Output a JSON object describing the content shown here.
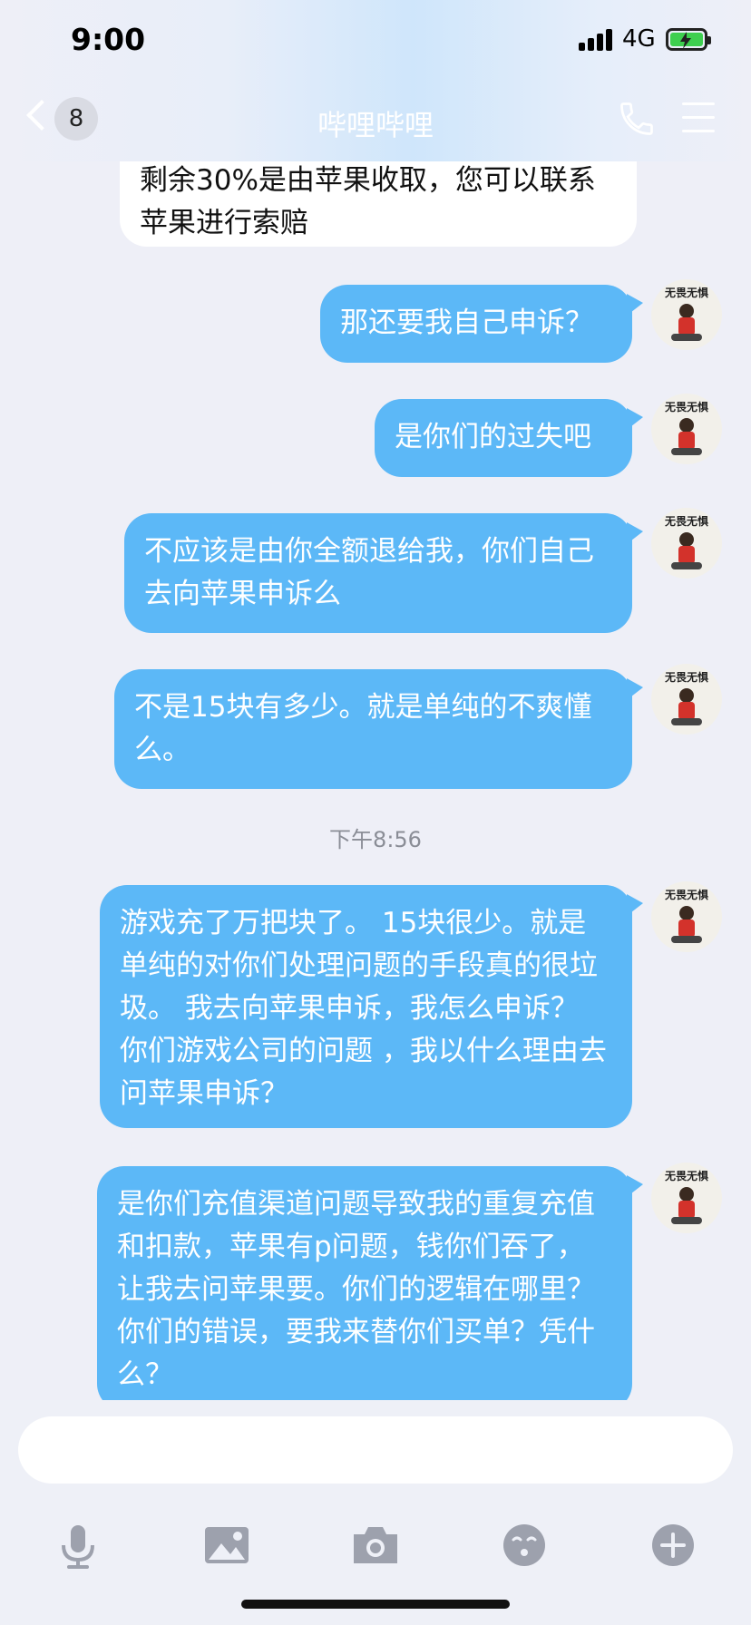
{
  "status_bar": {
    "time": "9:00",
    "network": "4G"
  },
  "nav": {
    "unread_count": "8",
    "title": "哔哩哔哩"
  },
  "messages": [
    {
      "direction": "in",
      "text": "剩余30%是由苹果收取，您可以联系苹果进行索赔"
    },
    {
      "direction": "out",
      "text": "那还要我自己申诉？"
    },
    {
      "direction": "out",
      "text": "是你们的过失吧"
    },
    {
      "direction": "out",
      "text": "不应该是由你全额退给我，你们自己去向苹果申诉么"
    },
    {
      "direction": "out",
      "text": "不是15块有多少。就是单纯的不爽懂么。"
    },
    {
      "direction": "out",
      "text": "游戏充了万把块了。 15块很少。就是单纯的对你们处理问题的手段真的很垃圾。 我去向苹果申诉，我怎么申诉？ 你们游戏公司的问题 ，我以什么理由去问苹果申诉？"
    },
    {
      "direction": "out",
      "text": "是你们充值渠道问题导致我的重复充值和扣款，苹果有p问题，钱你们吞了，让我去问苹果要。你们的逻辑在哪里？你们的错误，要我来替你们买单？凭什么？"
    }
  ],
  "timestamp": "下午8:56",
  "avatar_caption": "无畏无惧",
  "input": {
    "placeholder": "",
    "value": ""
  },
  "toolbar": [
    "microphone-icon",
    "image-icon",
    "camera-icon",
    "emoji-icon",
    "plus-icon"
  ],
  "colors": {
    "outgoing_bubble": "#5cb8f7",
    "incoming_bubble": "#ffffff",
    "background": "#eeeff7"
  }
}
